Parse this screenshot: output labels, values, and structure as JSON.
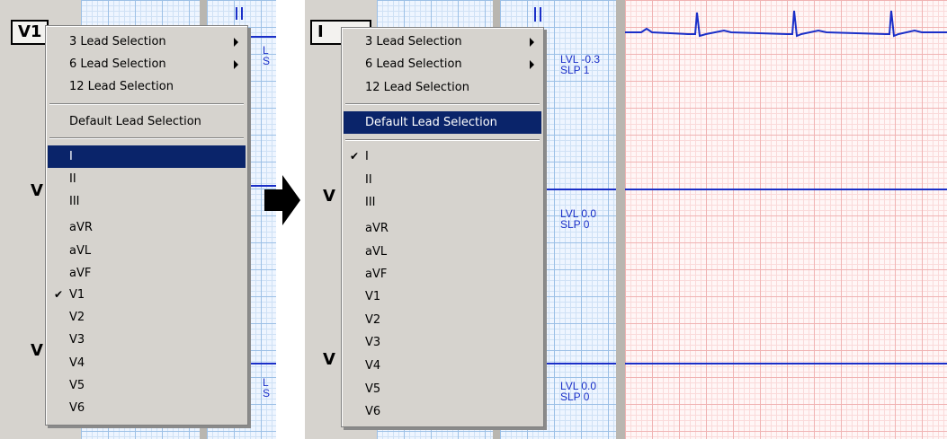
{
  "left_panel": {
    "lead_box": "V1",
    "side_labels": [
      "V",
      "V"
    ],
    "menu": {
      "items": [
        {
          "label": "3 Lead Selection",
          "submenu": true
        },
        {
          "label": "6 Lead Selection",
          "submenu": true
        },
        {
          "label": "12 Lead Selection"
        },
        {
          "label": "Default Lead Selection"
        },
        {
          "label": "I",
          "highlighted": true
        },
        {
          "label": "II"
        },
        {
          "label": "III"
        },
        {
          "label": "aVR"
        },
        {
          "label": "aVL"
        },
        {
          "label": "aVF"
        },
        {
          "label": "V1",
          "checked": true
        },
        {
          "label": "V2"
        },
        {
          "label": "V3"
        },
        {
          "label": "V4"
        },
        {
          "label": "V5"
        },
        {
          "label": "V6"
        }
      ],
      "check_glyph": "✔"
    },
    "partial_text": [
      "L",
      "S",
      "L",
      "S"
    ]
  },
  "right_panel": {
    "lead_box": "I",
    "side_labels": [
      "V",
      "V"
    ],
    "menu": {
      "items": [
        {
          "label": "3 Lead Selection",
          "submenu": true
        },
        {
          "label": "6 Lead Selection",
          "submenu": true
        },
        {
          "label": "12 Lead Selection"
        },
        {
          "label": "Default Lead Selection",
          "highlighted": true
        },
        {
          "label": "I",
          "checked": true
        },
        {
          "label": "II"
        },
        {
          "label": "III"
        },
        {
          "label": "aVR"
        },
        {
          "label": "aVL"
        },
        {
          "label": "aVF"
        },
        {
          "label": "V1"
        },
        {
          "label": "V2"
        },
        {
          "label": "V3"
        },
        {
          "label": "V4"
        },
        {
          "label": "V5"
        },
        {
          "label": "V6"
        }
      ],
      "check_glyph": "✔"
    },
    "channels": [
      {
        "lvl": "LVL -0.3",
        "slp": "SLP 1"
      },
      {
        "lvl": "LVL 0.0",
        "slp": "SLP 0"
      },
      {
        "lvl": "LVL 0.0",
        "slp": "SLP 0"
      }
    ]
  },
  "colors": {
    "menu_bg": "#d6d3ce",
    "highlight": "#0a246a",
    "trace": "#1a2fc8"
  },
  "icons": [
    "chevron-right-icon",
    "checkmark-icon",
    "right-arrow-icon"
  ]
}
